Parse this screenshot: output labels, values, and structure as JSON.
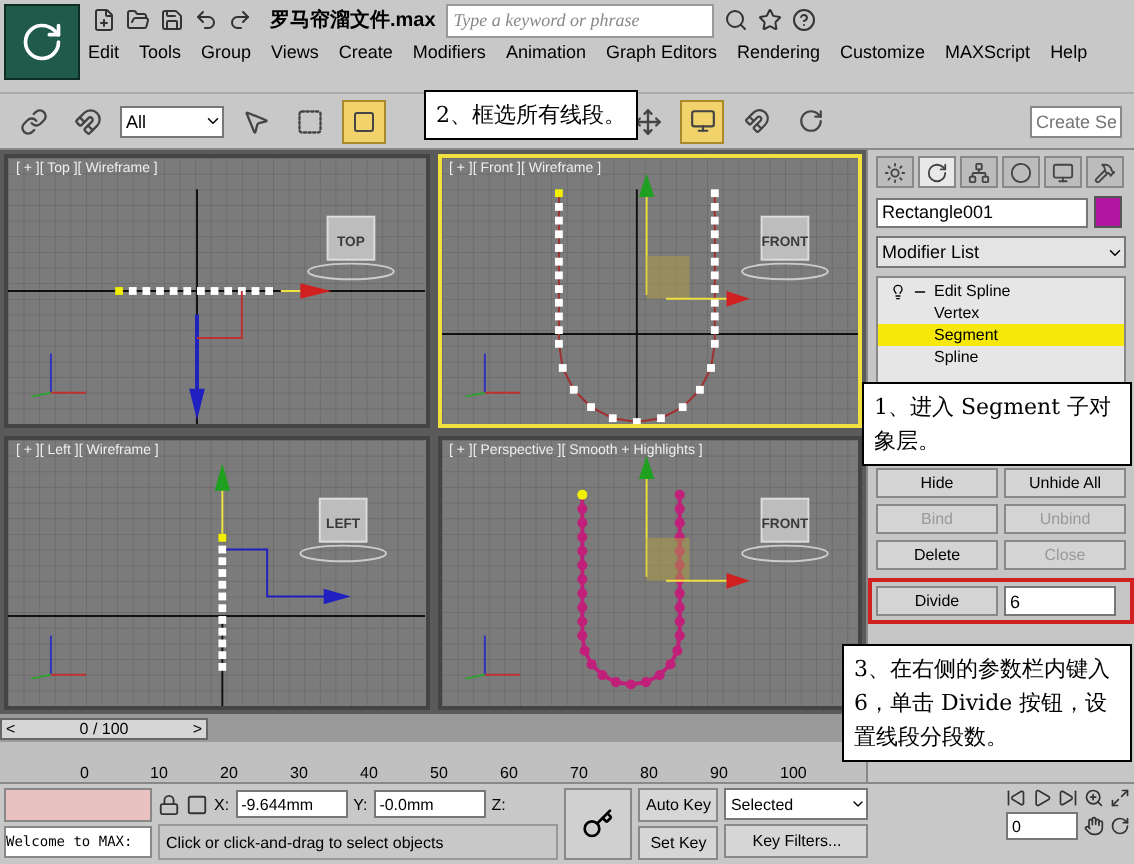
{
  "title_bar": {
    "file_name": "罗马帘溜文件.max",
    "search": {
      "placeholder": "Type a keyword or phrase"
    }
  },
  "menu": [
    "Edit",
    "Tools",
    "Group",
    "Views",
    "Create",
    "Modifiers",
    "Animation",
    "Graph Editors",
    "Rendering",
    "Customize",
    "MAXScript",
    "Help"
  ],
  "toolbar": {
    "selection_filter": "All",
    "named_selection": {
      "placeholder": "Create Se"
    }
  },
  "viewports": [
    {
      "label": "[ + ][ Top ][ Wireframe ]",
      "kind": "top",
      "selected": false,
      "cube_label": "TOP"
    },
    {
      "label": "[ + ][ Front ][ Wireframe ]",
      "kind": "front",
      "selected": true,
      "cube_label": "FRONT"
    },
    {
      "label": "[ + ][ Left ][ Wireframe ]",
      "kind": "left",
      "selected": false,
      "cube_label": "LEFT"
    },
    {
      "label": "[ + ][ Perspective ][ Smooth + Highlights ]",
      "kind": "perspective",
      "selected": false,
      "cube_label": "FRONT"
    }
  ],
  "command_panel": {
    "object_name": "Rectangle001",
    "modifier_list": "Modifier List",
    "stack": [
      {
        "label": "Edit Spline",
        "selected": false,
        "children": [
          {
            "label": "Vertex",
            "selected": false
          },
          {
            "label": "Segment",
            "selected": true
          },
          {
            "label": "Spline",
            "selected": false
          }
        ]
      }
    ],
    "buttons": [
      {
        "label": "Hide",
        "disabled": false
      },
      {
        "label": "Unhide All",
        "disabled": false
      },
      {
        "label": "Bind",
        "disabled": true
      },
      {
        "label": "Unbind",
        "disabled": true
      },
      {
        "label": "Delete",
        "disabled": false
      },
      {
        "label": "Close",
        "disabled": true
      }
    ],
    "divide": {
      "label": "Divide",
      "value": "6",
      "highlighted": true
    }
  },
  "callouts": [
    "2、框选所有线段。",
    "1、进入 Segment 子对象层。",
    "3、在右侧的参数栏内键入 6，单击 Divide 按钮，设置线段分段数。"
  ],
  "time_slider": {
    "prev": "<",
    "label": "0 / 100",
    "next": ">",
    "level": 0
  },
  "track_bar": {
    "ticks": [
      "0",
      "10",
      "20",
      "30",
      "40",
      "50",
      "60",
      "70",
      "80",
      "90",
      "100"
    ]
  },
  "status_bar": {
    "listener": "Welcome to MAX:",
    "x_label": "X:",
    "x": "-9.644mm",
    "y_label": "Y:",
    "y": "-0.0mm",
    "z_label": "Z:",
    "prompt": "Click or click-and-drag to select objects",
    "auto_key": "Auto Key",
    "set_key": "Set Key",
    "key_mode": "Selected",
    "key_filters": "Key Filters...",
    "frame": "0"
  }
}
